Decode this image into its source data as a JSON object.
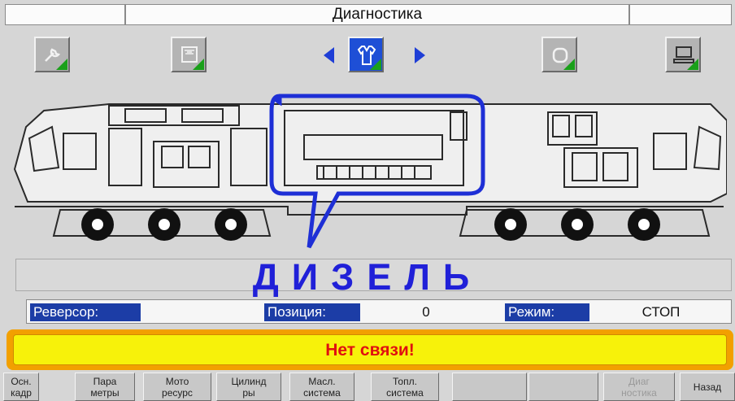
{
  "header": {
    "title": "Диагностика"
  },
  "sections": [
    {
      "icon": "wrench-icon",
      "active": false
    },
    {
      "icon": "panel-icon",
      "active": false
    },
    {
      "icon": "shirt-icon",
      "active": true
    },
    {
      "icon": "ring-icon",
      "active": false
    },
    {
      "icon": "printer-icon",
      "active": false
    }
  ],
  "colors": {
    "accent": "#1e4fd6",
    "alarm_bg": "#f7f20a",
    "alarm_text": "#e01010",
    "label_bg": "#1c3da6",
    "diesel": "#2020d8"
  },
  "component_label": "ДИЗЕЛЬ",
  "status": {
    "reversor_label": "Реверсор:",
    "reversor_value": "",
    "position_label": "Позиция:",
    "position_value": "0",
    "mode_label": "Режим:",
    "mode_value": "СТОП"
  },
  "alarm": {
    "text": "Нет связи!"
  },
  "menu": [
    {
      "label": "Осн.\nкадр",
      "enabled": true
    },
    {
      "label": "Пара\nметры",
      "enabled": true
    },
    {
      "label": "Мото\nресурс",
      "enabled": true
    },
    {
      "label": "Цилинд\nры",
      "enabled": true
    },
    {
      "label": "Масл.\nсистема",
      "enabled": true
    },
    {
      "label": "Топл.\nсистема",
      "enabled": true
    },
    {
      "label": "",
      "enabled": true
    },
    {
      "label": "",
      "enabled": true
    },
    {
      "label": "Диаг\nностика",
      "enabled": false
    },
    {
      "label": "Назад",
      "enabled": true
    }
  ]
}
